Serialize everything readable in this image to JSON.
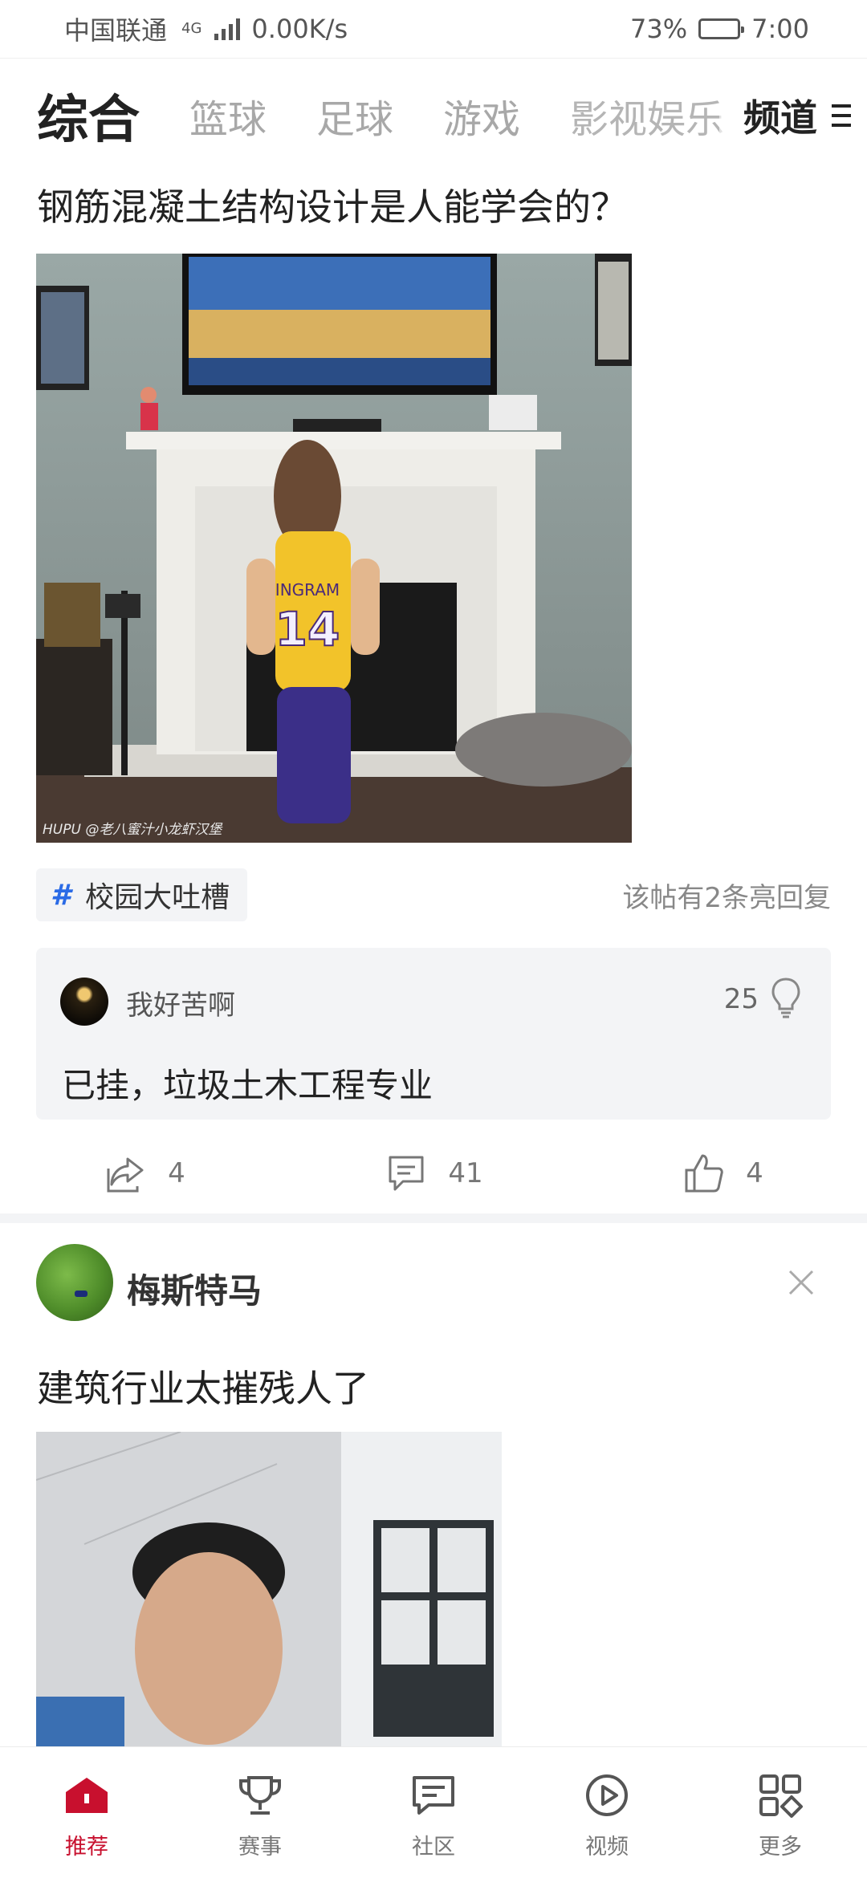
{
  "status_bar": {
    "carrier": "中国联通",
    "network_type": "4G",
    "speed": "0.00K/s",
    "battery_percent": "73%",
    "battery_level": 0.73,
    "time": "7:00"
  },
  "top_tabs": {
    "items": [
      {
        "label": "综合",
        "active": true
      },
      {
        "label": "篮球",
        "active": false
      },
      {
        "label": "足球",
        "active": false
      },
      {
        "label": "游戏",
        "active": false
      },
      {
        "label": "影视娱乐",
        "active": false
      }
    ],
    "channel_label": "频道"
  },
  "post1": {
    "title": "钢筋混凝土结构设计是人能学会的？",
    "image_watermark": "HUPU @老八蜜汁小龙虾汉堡",
    "jersey_name": "INGRAM",
    "jersey_number": "14",
    "topic": "校园大吐槽",
    "hot_reply_note": "该帖有2条亮回复",
    "reply": {
      "user": "我好苦啊",
      "likes": "25",
      "text": "已挂，垃圾土木工程专业"
    },
    "actions": {
      "share_count": "4",
      "comment_count": "41",
      "like_count": "4"
    }
  },
  "post2": {
    "author": "梅斯特马",
    "title": "建筑行业太摧残人了"
  },
  "bottom_nav": {
    "items": [
      {
        "label": "推荐",
        "icon": "home-icon",
        "active": true
      },
      {
        "label": "赛事",
        "icon": "trophy-icon",
        "active": false
      },
      {
        "label": "社区",
        "icon": "community-chat-icon",
        "active": false
      },
      {
        "label": "视频",
        "icon": "play-icon",
        "active": false
      },
      {
        "label": "更多",
        "icon": "more-grid-icon",
        "active": false
      }
    ]
  },
  "colors": {
    "accent_red": "#c8102e",
    "topic_blue": "#2b6be6",
    "card_bg": "#f3f4f6"
  }
}
